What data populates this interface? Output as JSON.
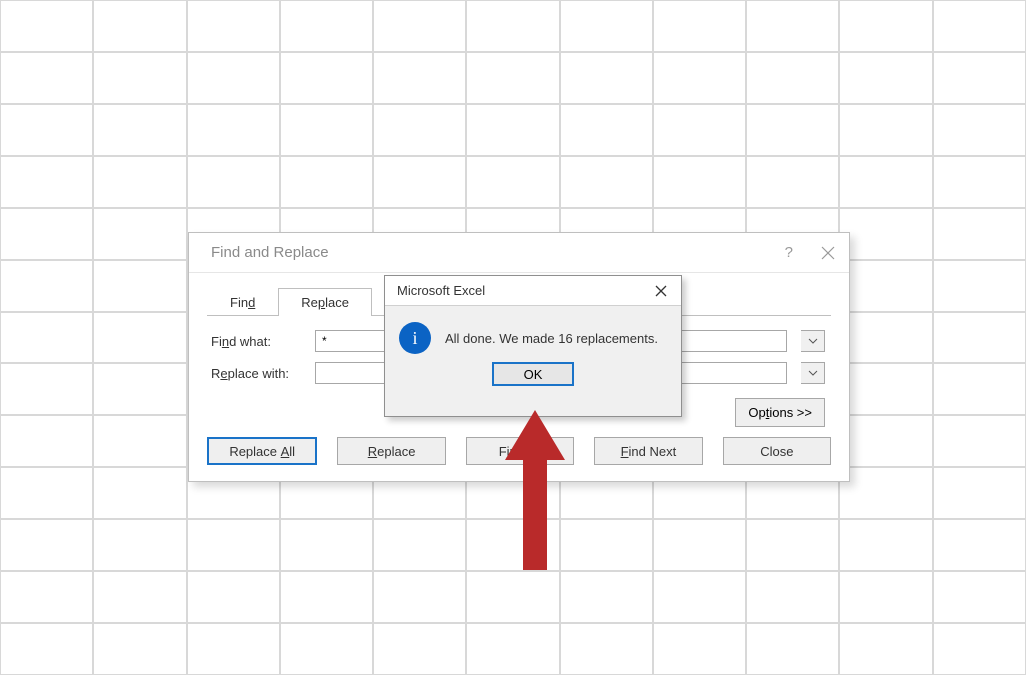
{
  "find_replace": {
    "title": "Find and Replace",
    "tabs": {
      "find": "Find",
      "replace": "Replace"
    },
    "labels": {
      "find_what": "Find what:",
      "replace_with": "Replace with:"
    },
    "find_what_value": "*",
    "replace_with_value": "",
    "options_button": "Options >>",
    "buttons": {
      "replace_all": "Replace All",
      "replace": "Replace",
      "find_all": "Find All",
      "find_next": "Find Next",
      "close": "Close"
    }
  },
  "msgbox": {
    "title": "Microsoft Excel",
    "message": "All done. We made 16 replacements.",
    "ok": "OK"
  }
}
